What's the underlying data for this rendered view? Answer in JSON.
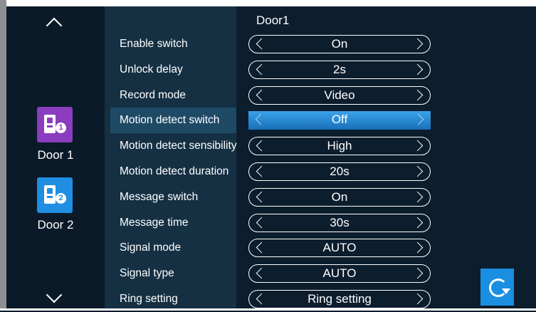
{
  "side": {
    "doors": [
      {
        "label": "Door 1",
        "badge": "1"
      },
      {
        "label": "Door 2",
        "badge": "2"
      }
    ]
  },
  "main": {
    "title": "Door1",
    "rows": [
      {
        "label": "Enable switch",
        "value": "On"
      },
      {
        "label": "Unlock delay",
        "value": "2s"
      },
      {
        "label": "Record mode",
        "value": "Video"
      },
      {
        "label": "Motion detect switch",
        "value": "Off"
      },
      {
        "label": "Motion detect sensibility",
        "value": "High"
      },
      {
        "label": "Motion detect duration",
        "value": "20s"
      },
      {
        "label": "Message switch",
        "value": "On"
      },
      {
        "label": "Message time",
        "value": "30s"
      },
      {
        "label": "Signal mode",
        "value": "AUTO"
      },
      {
        "label": "Signal type",
        "value": "AUTO"
      },
      {
        "label": "Ring setting",
        "value": "Ring setting"
      }
    ],
    "selected_row": 3
  },
  "icons": {
    "scroll_up": "chevron-up-icon",
    "scroll_down": "chevron-down-icon",
    "refresh": "refresh-icon"
  },
  "colors": {
    "accent": "#1a8ee0",
    "door1": "#8a3dbf",
    "door2": "#1f8ee3"
  }
}
